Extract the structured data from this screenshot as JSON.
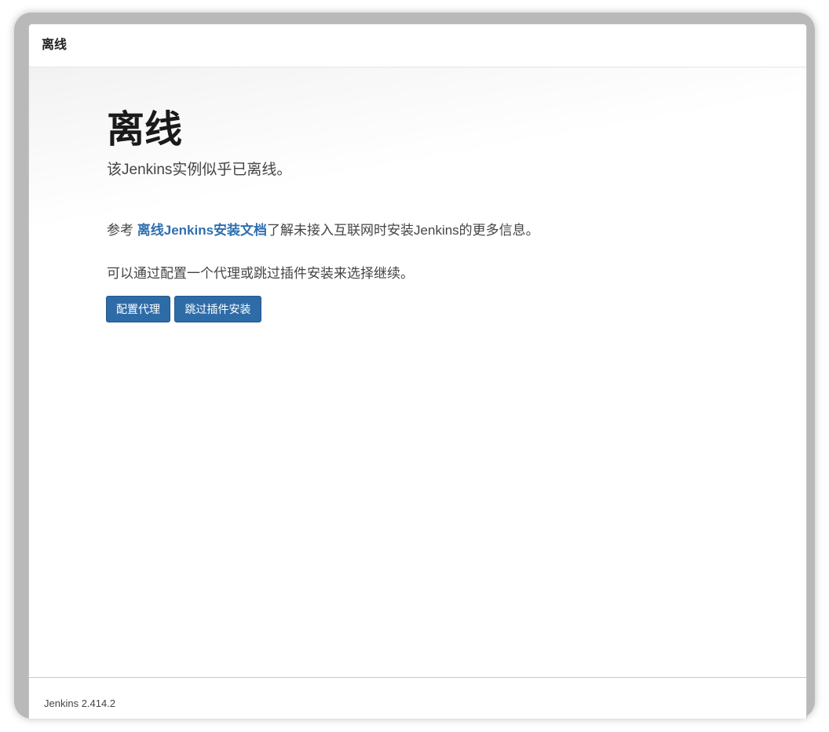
{
  "header": {
    "title": "离线"
  },
  "hero": {
    "title": "离线",
    "subtitle": "该Jenkins实例似乎已离线。"
  },
  "docs": {
    "prefix": "参考 ",
    "link_text": "离线Jenkins安装文档",
    "suffix": "了解未接入互联网时安装Jenkins的更多信息。"
  },
  "proxy": {
    "text": "可以通过配置一个代理或跳过插件安装来选择继续。"
  },
  "actions": {
    "configure_proxy_label": "配置代理",
    "skip_plugins_label": "跳过插件安装"
  },
  "footer": {
    "version": "Jenkins 2.414.2"
  },
  "colors": {
    "accent": "#2e6ca8",
    "link": "#2f6fb0",
    "text": "#444444",
    "heading": "#1a1a1a"
  }
}
